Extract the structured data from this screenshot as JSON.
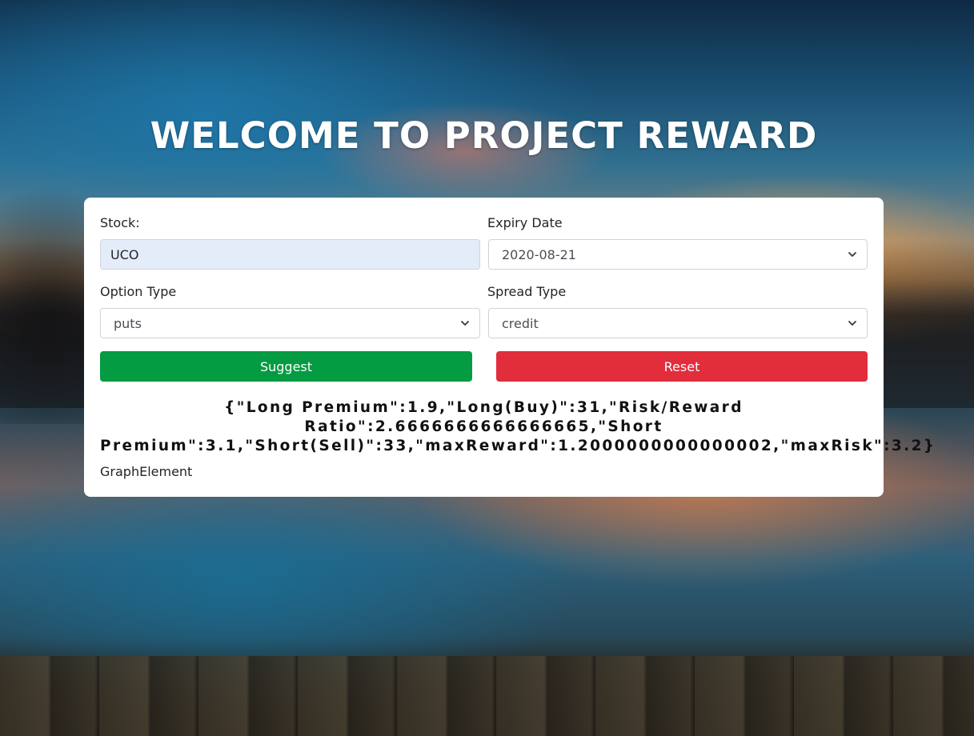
{
  "header": {
    "title": "WELCOME TO PROJECT REWARD"
  },
  "form": {
    "stock": {
      "label": "Stock:",
      "value": "UCO"
    },
    "expiry": {
      "label": "Expiry Date",
      "selected": "2020-08-21"
    },
    "option_type": {
      "label": "Option Type",
      "selected": "puts"
    },
    "spread_type": {
      "label": "Spread Type",
      "selected": "credit"
    },
    "buttons": {
      "suggest_label": "Suggest",
      "reset_label": "Reset"
    }
  },
  "result": {
    "json_line_1": "{\"Long Premium\":1.9,\"Long(Buy)\":31,\"Risk/Reward",
    "json_line_2": "Ratio\":2.6666666666666665,\"Short",
    "json_line_3": "Premium\":3.1,\"Short(Sell)\":33,\"maxReward\":1.2000000000000002,\"maxRisk\":3.2}",
    "graph_label": "GraphElement"
  },
  "colors": {
    "suggest": "#049b42",
    "reset": "#e12d3c",
    "input_autofill": "#e3ecf8",
    "card": "#ffffff"
  },
  "icons": {
    "select_arrow": "chevron-down-icon"
  }
}
